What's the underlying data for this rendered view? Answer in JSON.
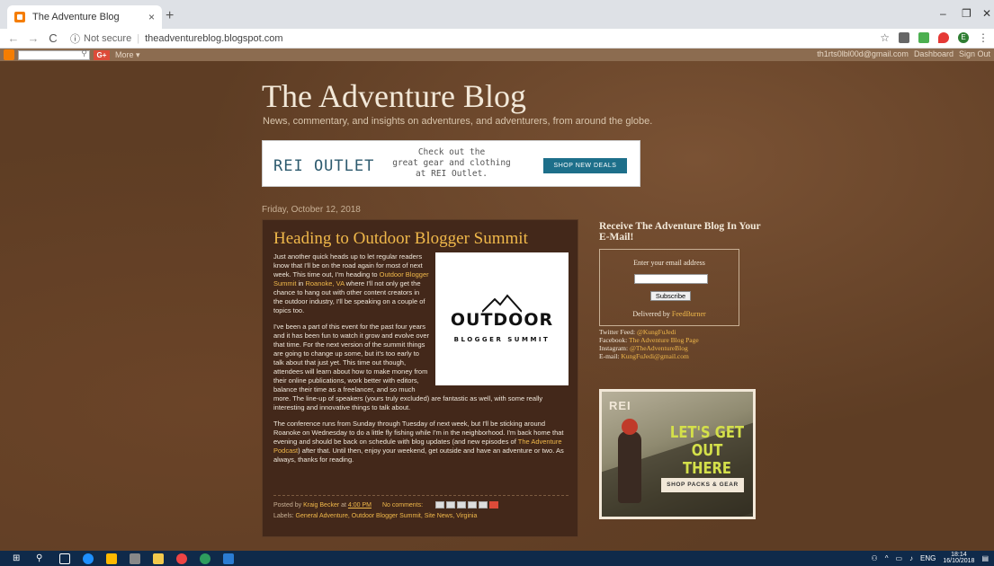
{
  "browser": {
    "tab_title": "The Adventure Blog",
    "tab_close": "×",
    "new_tab": "+",
    "not_secure": "Not secure",
    "url": "theadventureblog.blogspot.com",
    "minimize": "–",
    "maximize": "❐",
    "close": "✕",
    "profile_initial": "E"
  },
  "navbar": {
    "more": "More ▾",
    "gplus": "G+",
    "account": "th1rts0lbl00d@gmail.com",
    "dashboard": "Dashboard",
    "sign_out": "Sign Out"
  },
  "blog": {
    "title": "The Adventure Blog",
    "description": "News, commentary, and insights on adventures, and adventurers, from around the globe."
  },
  "top_ad": {
    "logo": "REI OUTLET",
    "copy_line1": "Check out the",
    "copy_line2": "great gear and clothing",
    "copy_line3": "at REI Outlet.",
    "button": "SHOP NEW DEALS"
  },
  "post": {
    "date": "Friday, October 12, 2018",
    "title": "Heading to Outdoor Blogger Summit",
    "image_word1": "OUTDOOR",
    "image_word2": "BLOGGER SUMMIT",
    "p1_a": "Just another quick heads up to let regular readers know that I'll be on the road again for most of next week. This time out, I'm heading to ",
    "p1_link1": "Outdoor Blogger Summit",
    "p1_b": " in ",
    "p1_link2": "Roanoke, VA",
    "p1_c": " where I'll not only get the chance to hang out with other content creators in the outdoor industry, I'll be speaking on a couple of topics too.",
    "p2": "I've been a part of this event for the past four years and it has been fun to watch it grow and evolve over that time. For the next version of the summit things are going to change up some, but it's too early to talk about that just yet. This time out though, attendees will learn about how to make money from their online publications, work better with editors, balance their time as a freelancer, and so much more. The line-up of speakers (yours truly excluded) are fantastic as well, with some really interesting and innovative things to talk about.",
    "p3_a": "The conference runs from Sunday through Tuesday of next week, but I'll be sticking around Roanoke on Wednesday to do a little fly fishing while I'm in the neighborhood. I'm back home that evening and should be back on schedule with blog updates (and new episodes of ",
    "p3_link": "The Adventure Podcast",
    "p3_b": ") after that. Until then, enjoy your weekend, get outside and have an adventure or two. As always, thanks for reading.",
    "posted_by": "Posted by",
    "author": "Kraig Becker",
    "at": "at",
    "time": "4:00 PM",
    "comments": "No comments:",
    "labels_prefix": "Labels:",
    "labels": "General Adventure, Outdoor Blogger Summit, Site News, Virginia"
  },
  "sidebar": {
    "subscribe_title": "Receive The Adventure Blog In Your E-Mail!",
    "email_label": "Enter your email address",
    "subscribe_button": "Subscribe",
    "delivered_by": "Delivered by",
    "feedburner": "FeedBurner",
    "twitter_label": "Twitter Feed:",
    "twitter": "@KungFuJedi",
    "facebook_label": "Facebook:",
    "facebook": "The Adventure Blog Page",
    "instagram_label": "Instagram:",
    "instagram": "@TheAdventureBlog",
    "email_contact_label": "E-mail:",
    "email_contact": "KungFuJedi@gmail.com"
  },
  "side_ad": {
    "logo": "REI",
    "headline": "LET'S GET OUT THERE",
    "cta": "SHOP PACKS & GEAR"
  },
  "taskbar": {
    "lang": "ENG",
    "time": "18:14",
    "date": "16/10/2018"
  }
}
